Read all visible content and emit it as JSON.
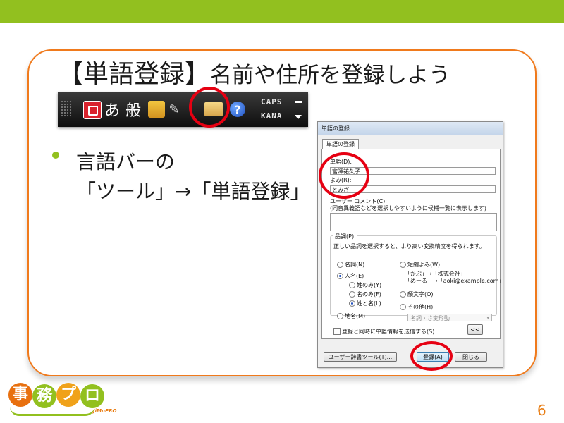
{
  "slide": {
    "bracket_title": "【単語登録】",
    "subtitle": "名前や住所を登録しよう",
    "bullet_line1": "言語バーの",
    "bullet_line2": "「ツール」→「単語登録」",
    "page_number": "6"
  },
  "language_bar": {
    "ime_mode": "あ",
    "dictionary_mode": "般",
    "caps_label": "CAPS",
    "kana_label": "KANA",
    "help_symbol": "?",
    "icons": [
      "ime-pad-icon",
      "ime-mode-icon",
      "dictionary-mode-icon",
      "conversion-mode-icon",
      "pen-icon",
      "tool-icon",
      "help-icon"
    ]
  },
  "dialog": {
    "title": "単語の登録",
    "tab": "単語の登録",
    "word_label": "単語(D):",
    "word_value": "富澤祐久子",
    "reading_label": "よみ(R):",
    "reading_value": "とみざ",
    "comment_label": "ユーザー コメント(C):",
    "comment_hint": "(同音異義語などを選択しやすいように候補一覧に表示します)",
    "pos_label": "品詞(P):",
    "pos_hint": "正しい品詞を選択すると、より高い変換精度を得られます。",
    "opt_noun": "名詞(N)",
    "opt_person": "人名(E)",
    "opt_surname": "姓のみ(Y)",
    "opt_givenname": "名のみ(F)",
    "opt_fullname": "姓と名(L)",
    "opt_place": "地名(M)",
    "opt_short": "短縮よみ(W)",
    "short_ex1": "「かぶ」→「株式会社」",
    "short_ex2": "「めーる」→「aoki@example.com」",
    "opt_emoticon": "顔文字(O)",
    "opt_other": "その他(H)",
    "other_select": "名詞・さ変形動",
    "expand_btn": "<<",
    "send_info": "登録と同時に単語情報を送信する(S)",
    "user_dict_btn": "ユーザー辞書ツール(T)...",
    "register_btn": "登録(A)",
    "close_btn": "閉じる"
  },
  "logo": {
    "chars": [
      "事",
      "務",
      "プ",
      "ロ"
    ],
    "tagline": "JiMuPRO",
    "colors": [
      "#e8700f",
      "#92c01f",
      "#f0a21a",
      "#92c01f"
    ]
  },
  "colors": {
    "accent_green": "#92c01f",
    "accent_orange": "#f07a1c",
    "highlight_red": "#e60012"
  }
}
